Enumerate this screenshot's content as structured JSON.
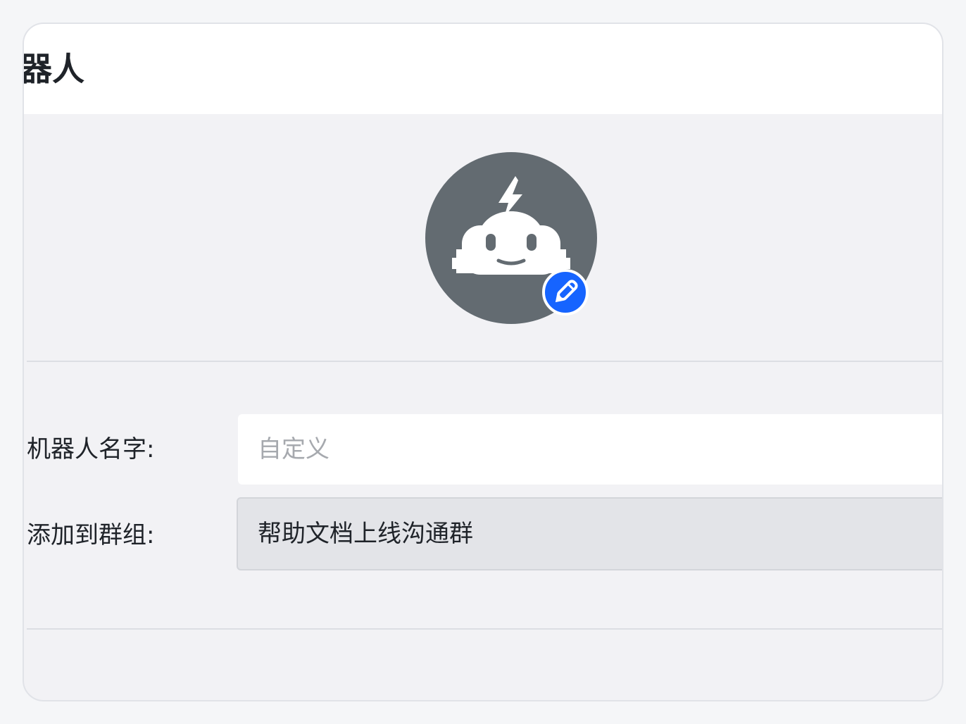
{
  "header": {
    "title": "器人"
  },
  "avatar": {
    "icon": "robot-icon",
    "edit_icon": "pencil-icon",
    "background_color": "#636b71",
    "edit_badge_color": "#1664ff"
  },
  "form": {
    "name_label": "机器人名字:",
    "name_placeholder": "自定义",
    "name_value": "",
    "group_label": "添加到群组:",
    "group_value": "帮助文档上线沟通群"
  }
}
